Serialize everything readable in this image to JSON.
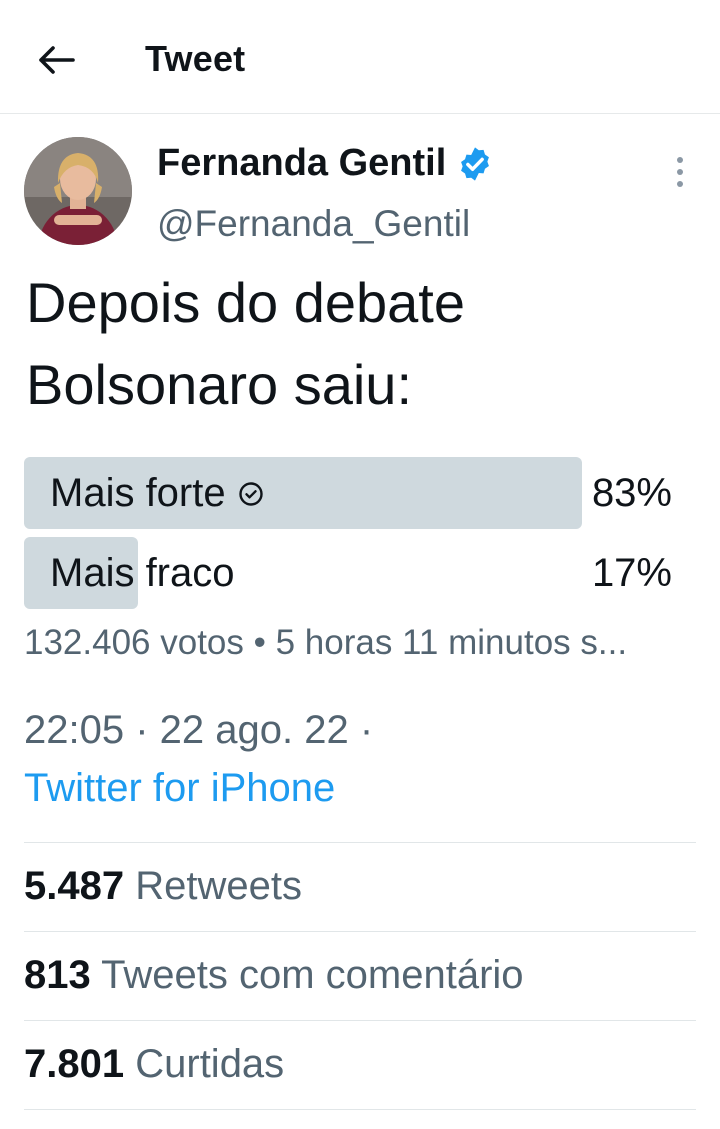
{
  "header": {
    "title": "Tweet"
  },
  "author": {
    "name": "Fernanda Gentil",
    "handle": "@Fernanda_Gentil",
    "verified": true
  },
  "tweet": {
    "lines": [
      "Depois do debate",
      "Bolsonaro saiu:"
    ]
  },
  "poll": {
    "options": [
      {
        "label": "Mais forte",
        "percent_text": "83%",
        "share": 0.83,
        "winner": true
      },
      {
        "label": "Mais fraco",
        "percent_text": "17%",
        "share": 0.17,
        "winner": false
      }
    ],
    "meta": "132.406 votos • 5 horas 11 minutos s..."
  },
  "timestamp": "22:05 · 22 ago. 22 ·",
  "source": "Twitter for iPhone",
  "stats": {
    "retweets": {
      "count": "5.487",
      "label": "Retweets"
    },
    "quotes": {
      "count": "813",
      "label": "Tweets com comentário"
    },
    "likes": {
      "count": "7.801",
      "label": "Curtidas"
    }
  },
  "colors": {
    "accent": "#1d9bf0",
    "poll_bar": "#cfd9de",
    "secondary_text": "#536471"
  }
}
